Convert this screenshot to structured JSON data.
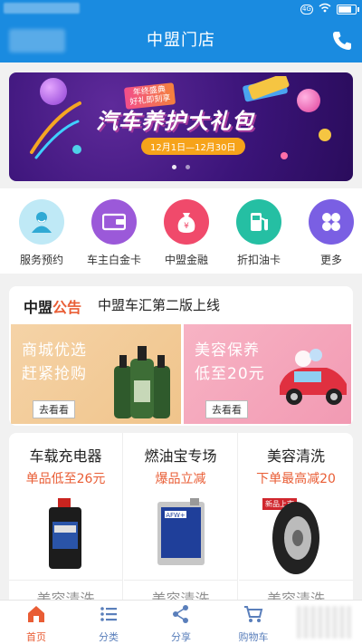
{
  "header": {
    "title": "中盟门店",
    "phone_icon": "phone-icon"
  },
  "banner": {
    "tag_line1": "年终盛典",
    "tag_line2": "好礼即刻享",
    "title": "汽车养护大礼包",
    "date_range": "12月1日—12月30日",
    "slide_count": 2,
    "active_slide": 0
  },
  "quick_links": [
    {
      "label": "服务预约",
      "icon": "person-icon",
      "color": "#66c9e6"
    },
    {
      "label": "车主白金卡",
      "icon": "wallet-icon",
      "color": "#9b59d9"
    },
    {
      "label": "中盟金融",
      "icon": "money-bag-icon",
      "color": "#f04a6b"
    },
    {
      "label": "折扣油卡",
      "icon": "fuel-pump-icon",
      "color": "#25bfa3"
    },
    {
      "label": "更多",
      "icon": "grid-icon",
      "color": "#7a5fe3"
    }
  ],
  "notice": {
    "brand_part1": "中盟",
    "brand_part2": "公告",
    "text": "中盟车汇第二版上线"
  },
  "promos": [
    {
      "line1": "商城优选",
      "line2": "赶紧抢购",
      "button": "去看看"
    },
    {
      "line1": "美容保养",
      "line2": "低至20元",
      "button": "去看看"
    }
  ],
  "products": [
    {
      "title": "车载充电器",
      "subtitle": "单品低至26元"
    },
    {
      "title": "燃油宝专场",
      "subtitle": "爆品立减"
    },
    {
      "title": "美容清洗",
      "subtitle": "下单最高减20"
    }
  ],
  "products_next_row": [
    "美容清洗",
    "美容清洗",
    "美容清洗"
  ],
  "product_extra": {
    "badge": "新品上市",
    "can_label": "AFW+"
  },
  "tabs": [
    {
      "label": "首页",
      "icon": "home-icon",
      "active": true
    },
    {
      "label": "分类",
      "icon": "list-icon",
      "active": false
    },
    {
      "label": "分享",
      "icon": "share-icon",
      "active": false
    },
    {
      "label": "购物车",
      "icon": "cart-icon",
      "active": false
    }
  ],
  "colors": {
    "header_bg": "#1a8be0",
    "accent_orange": "#e95d35",
    "tab_inactive": "#5a7fbb"
  }
}
